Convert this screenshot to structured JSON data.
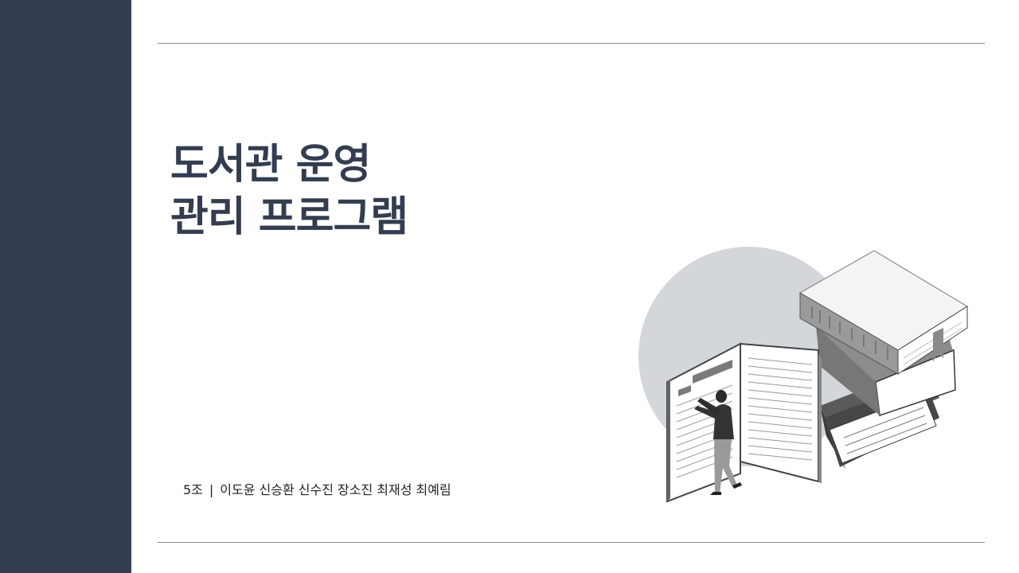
{
  "slide": {
    "title_line1": "도서관 운영",
    "title_line2": "관리 프로그램",
    "team": "5조",
    "separator": "|",
    "members": "이도윤 신승환 신수진 장소진 최재성 최예림"
  },
  "colors": {
    "sidebar": "#333d4f",
    "title": "#333d4f",
    "rule": "#8a8a8a",
    "circle": "#d3d6da"
  },
  "illustration": {
    "icon": "person-reading-giant-books-icon"
  }
}
